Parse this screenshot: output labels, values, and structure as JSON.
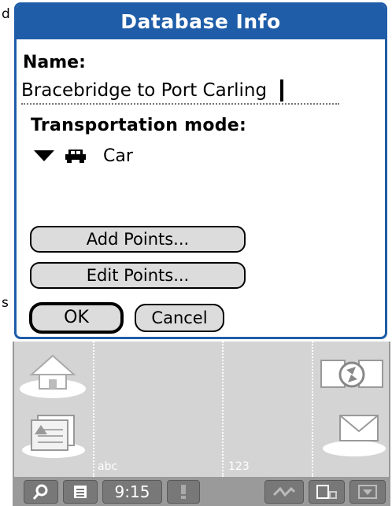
{
  "background": {
    "letter_top": "d",
    "letter_bottom": "s"
  },
  "dialog": {
    "title": "Database Info",
    "name_label": "Name:",
    "name_value": "Bracebridge to Port Carling",
    "mode_label": "Transportation mode:",
    "mode_value": "Car",
    "add_points_label": "Add Points...",
    "edit_points_label": "Edit Points...",
    "ok_label": "OK",
    "cancel_label": "Cancel"
  },
  "silkscreen": {
    "abc_label": "abc",
    "num_label": "123"
  },
  "statusbar": {
    "time": "9:15"
  },
  "colors": {
    "title_bar": "#1f5da8",
    "silkscreen": "#d4d4d4",
    "statusbar": "#9a9a9a"
  },
  "icons": [
    "home-icon",
    "find-icon",
    "menu-icon",
    "alert-icon",
    "graffiti-icon",
    "input-toggle-icon",
    "hide-icon",
    "sync-icon",
    "mail-icon",
    "calendar-icon",
    "car-icon",
    "dropdown-triangle-icon"
  ]
}
